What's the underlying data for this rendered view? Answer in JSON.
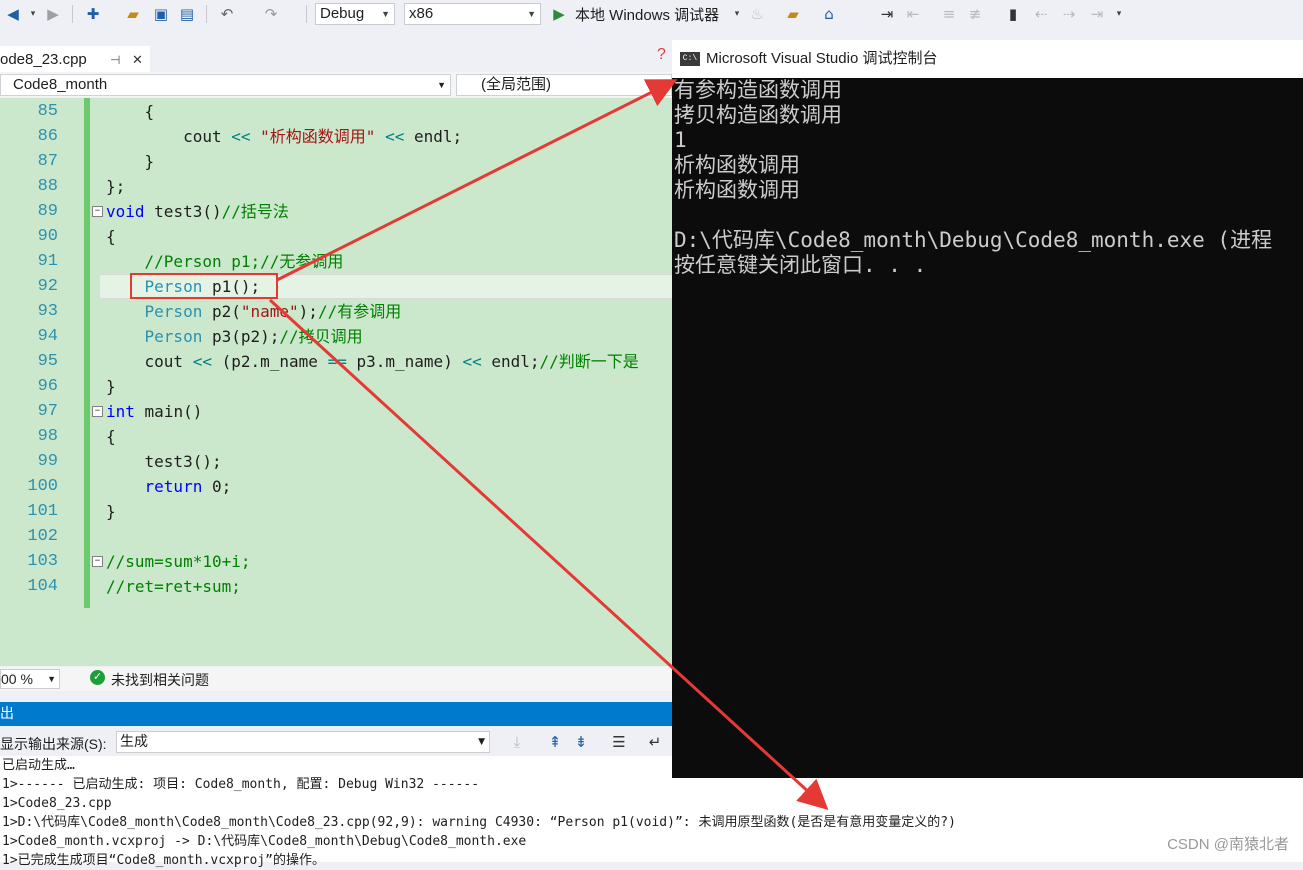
{
  "toolbar": {
    "config": "Debug",
    "platform": "x86",
    "run_label": "本地 Windows 调试器"
  },
  "tab": {
    "file": "ode8_23.cpp",
    "pin": "⊣",
    "close": "✕"
  },
  "nav": {
    "project": "Code8_month",
    "scope": "(全局范围)"
  },
  "code_lines": [
    {
      "n": "85",
      "t": "    {"
    },
    {
      "n": "86",
      "t": "        cout << \"析构函数调用\" << endl;"
    },
    {
      "n": "87",
      "t": "    }"
    },
    {
      "n": "88",
      "t": "};"
    },
    {
      "n": "89",
      "t": "void test3()//括号法"
    },
    {
      "n": "90",
      "t": "{"
    },
    {
      "n": "91",
      "t": "    //Person p1;//无参调用"
    },
    {
      "n": "92",
      "t": "    Person p1();"
    },
    {
      "n": "93",
      "t": "    Person p2(\"name\");//有参调用"
    },
    {
      "n": "94",
      "t": "    Person p3(p2);//拷贝调用"
    },
    {
      "n": "95",
      "t": "    cout << (p2.m_name == p3.m_name) << endl;//判断一下是"
    },
    {
      "n": "96",
      "t": "}"
    },
    {
      "n": "97",
      "t": "int main()"
    },
    {
      "n": "98",
      "t": "{"
    },
    {
      "n": "99",
      "t": "    test3();"
    },
    {
      "n": "100",
      "t": "    return 0;"
    },
    {
      "n": "101",
      "t": "}"
    },
    {
      "n": "102",
      "t": ""
    },
    {
      "n": "103",
      "t": "//sum=sum*10+i;"
    },
    {
      "n": "104",
      "t": "//ret=ret+sum;"
    }
  ],
  "status": {
    "zoom": "00 %",
    "issues": "未找到相关问题"
  },
  "output": {
    "header": "出",
    "source_label": "显示输出来源(S):",
    "source_value": "生成",
    "lines": [
      "已启动生成…",
      "1>------ 已启动生成: 项目: Code8_month, 配置: Debug Win32 ------",
      "1>Code8_23.cpp",
      "1>D:\\代码库\\Code8_month\\Code8_month\\Code8_23.cpp(92,9): warning C4930: “Person p1(void)”: 未调用原型函数(是否是有意用变量定义的?)",
      "1>Code8_month.vcxproj -> D:\\代码库\\Code8_month\\Debug\\Code8_month.exe",
      "1>已完成生成项目“Code8_month.vcxproj”的操作。"
    ]
  },
  "console": {
    "icon": "C:\\",
    "title": "Microsoft Visual Studio 调试控制台",
    "lines": [
      "有参构造函数调用",
      "拷贝构造函数调用",
      "1",
      "析构函数调用",
      "析构函数调用",
      "",
      "D:\\代码库\\Code8_month\\Debug\\Code8_month.exe (进程",
      "按任意键关闭此窗口. . ."
    ]
  },
  "question_mark": "?",
  "watermark": "CSDN @南猿北者",
  "colors": {
    "annotation_red": "#e53935",
    "editor_bg": "#cce8cc",
    "console_bg": "#0c0c0c",
    "accent": "#007acc"
  }
}
